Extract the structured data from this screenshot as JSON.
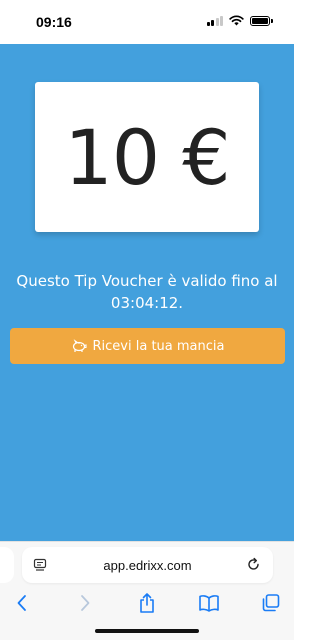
{
  "status_bar": {
    "time": "09:16",
    "icons": [
      "cellular-signal-icon",
      "wifi-icon",
      "battery-icon"
    ]
  },
  "voucher": {
    "amount": "10 €",
    "validity_line1": "Questo Tip Voucher è valido fino al",
    "validity_line2": "03:04:12.",
    "button_label": "Ricevi la tua mancia",
    "button_icon": "piggy-bank-icon"
  },
  "browser": {
    "url": "app.edrixx.com",
    "toolbar_icons": [
      "back-icon",
      "forward-icon",
      "share-icon",
      "bookmarks-icon",
      "tabs-icon"
    ]
  },
  "colors": {
    "background_blue": "#43a0dd",
    "button_orange": "#f0a840",
    "card_white": "#ffffff",
    "ios_blue": "#1a7cf5"
  }
}
